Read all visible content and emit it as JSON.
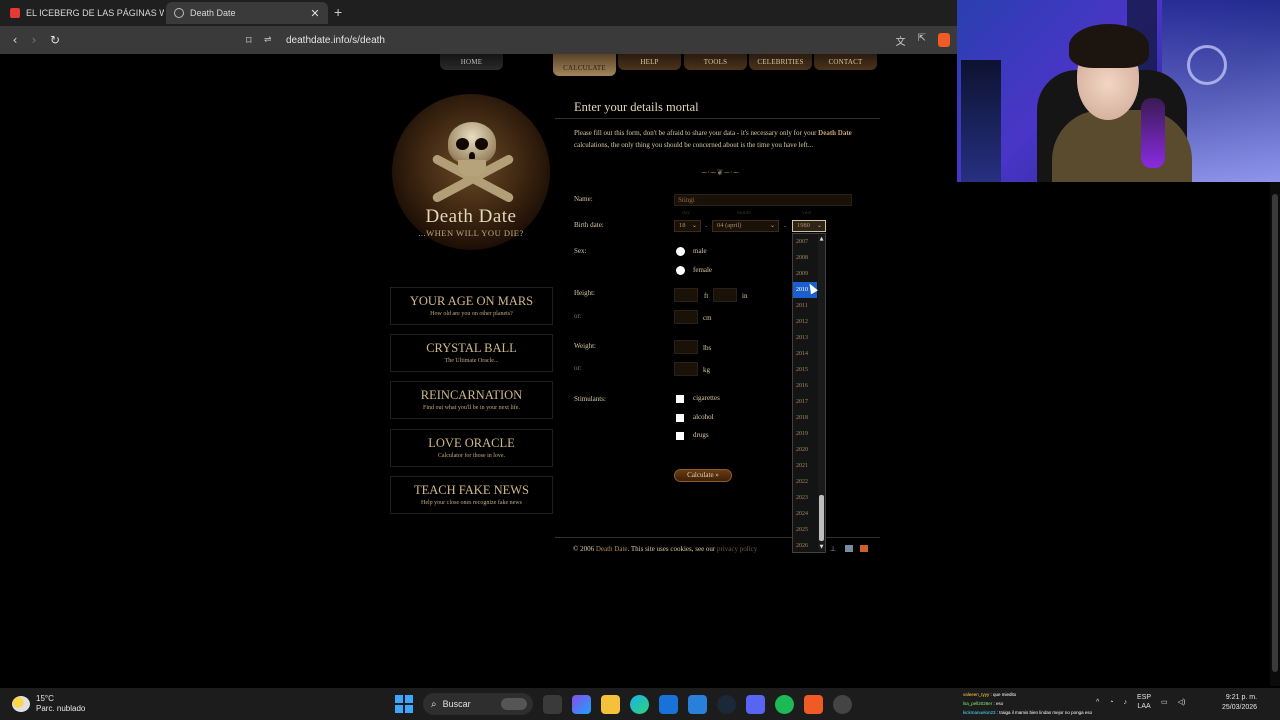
{
  "browser": {
    "tabs": [
      {
        "title": "EL ICEBERG DE LAS PÁGINAS WEB AL",
        "icon": "youtube-icon"
      },
      {
        "title": "Death Date",
        "icon": "globe-icon",
        "active": true
      }
    ],
    "url": "deathdate.info/s/death"
  },
  "site_nav": [
    "HOME",
    "CALCULATE",
    "HELP",
    "TOOLS",
    "CELEBRITIES",
    "CONTACT"
  ],
  "logo": {
    "title": "Death Date",
    "subtitle": "...WHEN WILL YOU DIE?"
  },
  "side_menu": [
    {
      "title": "YOUR AGE ON MARS",
      "subtitle": "How old are you on other planets?"
    },
    {
      "title": "CRYSTAL BALL",
      "subtitle": "The Ultimate Oracle..."
    },
    {
      "title": "REINCARNATION",
      "subtitle": "Find out what you'll be in your next life."
    },
    {
      "title": "LOVE ORACLE",
      "subtitle": "Calculator for those in love."
    },
    {
      "title": "TEACH FAKE NEWS",
      "subtitle": "Help your close ones recognize fake news"
    }
  ],
  "form": {
    "heading": "Enter your details mortal",
    "intro_before": "Please fill out this form, don't be afraid to share your data - it's necessary only for your ",
    "intro_bold": "Death Date",
    "intro_after": " calculations, the only thing you should be concerned about is the time you have left...",
    "ornament": "~·~❦~·~",
    "labels": {
      "name": "Name:",
      "birth_date": "Birth date:",
      "sex": "Sex:",
      "height": "Height:",
      "or": "or:",
      "weight": "Weight:",
      "stimulants": "Stimulants:"
    },
    "name_value": "Stingi",
    "birth": {
      "day_hint": "day",
      "month_hint": "month",
      "year_hint": "year",
      "day": "18",
      "month": "04 (april)",
      "year": "1980",
      "separator": "-"
    },
    "sex_options": [
      "male",
      "female"
    ],
    "units": {
      "ft": "ft",
      "in": "in",
      "cm": "cm",
      "lbs": "lbs",
      "kg": "kg"
    },
    "stimulants": [
      "cigarettes",
      "alcohol",
      "drugs"
    ],
    "calculate_button": "Calculate »"
  },
  "footer": {
    "copyright": "© 2006",
    "site": "Death Date",
    "text": ". This site uses cookies, see our",
    "policy": "privacy policy"
  },
  "year_dropdown": {
    "years": [
      "2007",
      "2008",
      "2009",
      "2010",
      "2011",
      "2012",
      "2013",
      "2014",
      "2015",
      "2016",
      "2017",
      "2018",
      "2019",
      "2020",
      "2021",
      "2022",
      "2023",
      "2024",
      "2025",
      "2026"
    ],
    "highlighted": "2010"
  },
  "chat": [
    {
      "user": "valeeen_tyyy",
      "msg": "que miedito"
    },
    {
      "user": "lsa_pell2026er",
      "msg": "eso"
    },
    {
      "user": "kickmanuelon23",
      "msg": "traiga il mamis bien lindas mejor no ponga eso"
    }
  ],
  "taskbar": {
    "temperature": "15°C",
    "weather": "Parc. nublado",
    "search": "Buscar",
    "lang_top": "ESP",
    "lang_bottom": "LAA",
    "time": "9:21 p. m.",
    "date": "25/03/2026"
  }
}
